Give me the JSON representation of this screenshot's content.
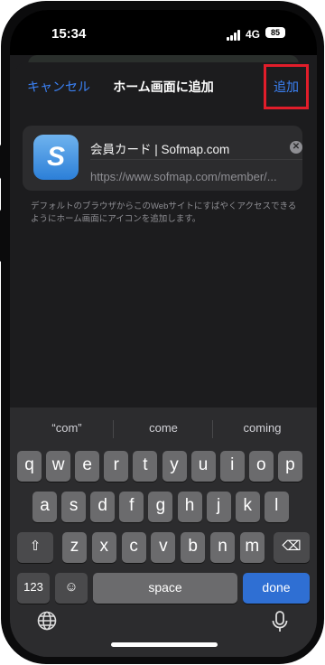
{
  "status": {
    "time": "15:34",
    "network": "4G",
    "battery": "85"
  },
  "nav": {
    "cancel_label": "キャンセル",
    "title": "ホーム画面に追加",
    "add_label": "追加"
  },
  "card": {
    "app_icon_letter": "S",
    "app_name": "会員カード | Sofmap.com",
    "url": "https://www.sofmap.com/member/...",
    "clear_icon": "clear-icon"
  },
  "description": "デフォルトのブラウザからこのWebサイトにすばやくアクセスできるようにホーム画面にアイコンを追加します。",
  "suggestions": [
    "“com”",
    "come",
    "coming"
  ],
  "keyboard": {
    "row1": [
      "q",
      "w",
      "e",
      "r",
      "t",
      "y",
      "u",
      "i",
      "o",
      "p"
    ],
    "row2": [
      "a",
      "s",
      "d",
      "f",
      "g",
      "h",
      "j",
      "k",
      "l"
    ],
    "row3": [
      "z",
      "x",
      "c",
      "v",
      "b",
      "n",
      "m"
    ],
    "shift_icon": "shift-icon",
    "backspace_icon": "backspace-icon",
    "numbers_label": "123",
    "emoji_icon": "emoji-icon",
    "space_label": "space",
    "done_label": "done",
    "globe_icon": "globe-icon",
    "mic_icon": "mic-icon"
  },
  "colors": {
    "accent": "#3b82f6",
    "highlight_border": "#e11d2a",
    "done_key": "#2f6fd3"
  }
}
